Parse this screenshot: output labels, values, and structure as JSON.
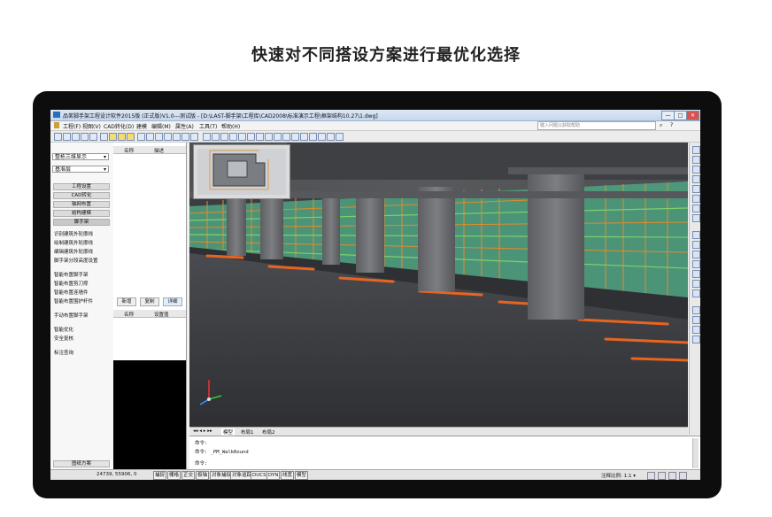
{
  "headline": "快速对不同搭设方案进行最优化选择",
  "window": {
    "title": "品茗脚手架工程设计软件2015版 (正式版)V1.0---测试版 - [D:\\LAST-脚手架\\工程库\\CAD2008\\标准演示工程\\框架结构10.27\\1.dwg]",
    "search_placeholder": "键入问题以获取帮助",
    "controls": [
      "—",
      "□",
      "✕"
    ]
  },
  "menu": [
    "工程(F)",
    "视图(V)",
    "CAD转化(D)",
    "建模",
    "编辑(M)",
    "属性(A)",
    "工具(T)",
    "帮助(H)"
  ],
  "left_panel": {
    "view_mode": "整栋三维显示",
    "floor": "基准层",
    "section_buttons": [
      "工程设置",
      "CAD转化",
      "轴网布置",
      "结构建模",
      "脚手架"
    ],
    "items": [
      "识别建筑外轮廓线",
      "绘制建筑外轮廓线",
      "编辑建筑外轮廓线",
      "脚手架分段高度设置",
      "智能布置脚手架",
      "智能布置剪刀撑",
      "智能布置连墙件",
      "智能布置围护杆件",
      "手动布置脚手架",
      "智能优化",
      "安全复核",
      "标注查询"
    ],
    "bottom_label": "图纸方案"
  },
  "mid_panel": {
    "col_name": "名称",
    "col_desc": "描述",
    "btn_add": "新增",
    "btn_copy": "复制",
    "btn_detail": "详细",
    "col_name2": "名称",
    "col_value": "设置值"
  },
  "viewport_tabs": [
    "模型",
    "布局1",
    "布局2"
  ],
  "command": {
    "line1": "命令:",
    "line2": "命令: _PM_WalkRound",
    "line3": "命令:"
  },
  "status": {
    "coords": "24739, 55906, 0",
    "toggles": [
      "捕捉",
      "栅格",
      "正交",
      "极轴",
      "对象捕捉",
      "对象追踪",
      "DUCS",
      "DYN",
      "线宽",
      "模型"
    ],
    "annotation": "注释比例: 1:1 ▾"
  },
  "colors": {
    "scaffold_orange": "#e58a2b",
    "net_green": "#4fa381",
    "pipe_orange": "#e8641f",
    "floor_dark": "#3a3b40",
    "column_gray": "#6f7175"
  }
}
